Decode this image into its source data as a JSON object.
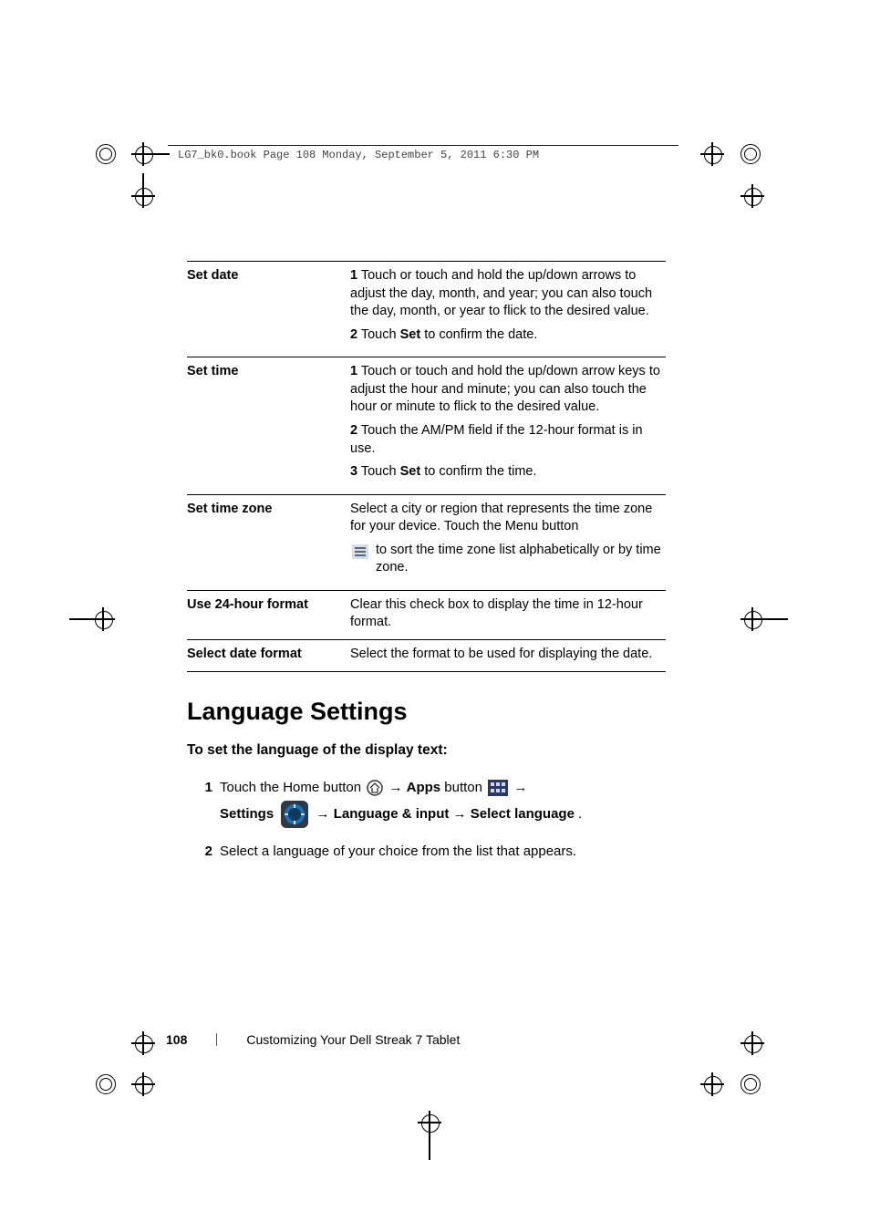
{
  "print_header": "LG7_bk0.book  Page 108  Monday, September 5, 2011  6:30 PM",
  "table": {
    "rows": [
      {
        "label": "Set date",
        "steps": [
          {
            "num": "1",
            "text": "Touch or touch and hold the up/down arrows to adjust the day, month, and year; you can also touch the day, month, or year to flick to the desired value."
          },
          {
            "num": "2",
            "prefix": "Touch ",
            "bold": "Set",
            "suffix": " to confirm the date."
          }
        ]
      },
      {
        "label": "Set time",
        "steps": [
          {
            "num": "1",
            "text": "Touch or touch and hold the up/down arrow keys to adjust the hour and minute; you can also touch the hour or minute to flick to the desired value."
          },
          {
            "num": "2",
            "text": "Touch the AM/PM field if the 12-hour format is in use."
          },
          {
            "num": "3",
            "prefix": "Touch ",
            "bold": "Set",
            "suffix": " to confirm the time."
          }
        ]
      },
      {
        "label": "Set time zone",
        "para": "Select a city or region that represents the time zone for your device. Touch the Menu button",
        "after_icon": " to sort the time zone list alphabetically or by time zone."
      },
      {
        "label": "Use 24-hour format",
        "text": "Clear this check box to display the time in 12-hour format."
      },
      {
        "label": "Select date format",
        "text": "Select the format to be used for displaying the date."
      }
    ]
  },
  "section_title": "Language Settings",
  "subheading": "To set the language of the display text:",
  "proc": {
    "step1": {
      "num": "1",
      "t1": "Touch the Home button ",
      "t2": " → ",
      "apps": "Apps",
      "t3": " button ",
      "t4": " →",
      "settings": "Settings",
      "t5": " → ",
      "lang_input": "Language & input",
      "t6": "→ ",
      "select_lang": "Select language",
      "t7": "."
    },
    "step2": {
      "num": "2",
      "text": "Select a language of your choice from the list that appears."
    }
  },
  "footer": {
    "page_number": "108",
    "chapter": "Customizing Your Dell Streak 7 Tablet"
  },
  "icons": {
    "home": "home-icon",
    "apps": "apps-grid-icon",
    "settings": "settings-gear-icon",
    "menu": "hamburger-menu-icon"
  }
}
